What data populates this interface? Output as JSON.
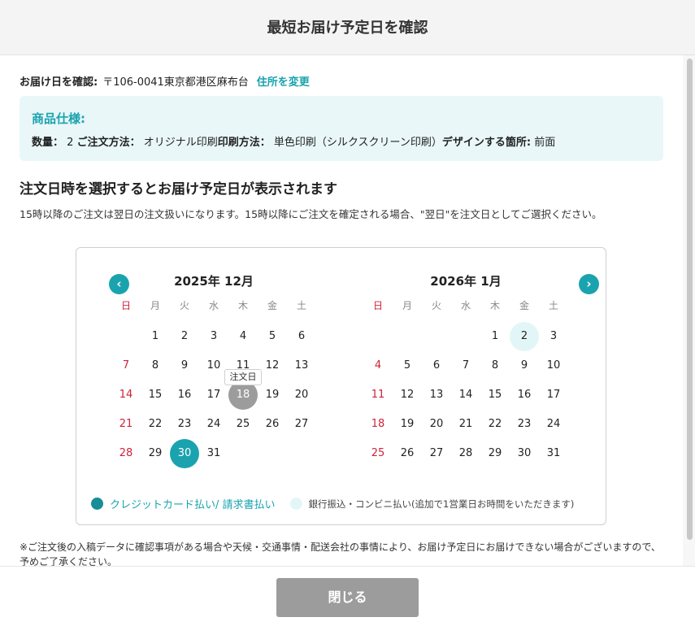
{
  "header": {
    "title": "最短お届け予定日を確認"
  },
  "address": {
    "label": "お届け日を確認:",
    "value": "〒106-0041東京都港区麻布台",
    "change_link": "住所を変更"
  },
  "spec": {
    "title": "商品仕様:",
    "quantity_label": "数量：",
    "quantity_value": "2",
    "order_method_label": "ご注文方法：",
    "order_method_value": "オリジナル印刷",
    "print_method_label": "印刷方法：",
    "print_method_value": "単色印刷（シルクスクリーン印刷）",
    "design_label": "デザインする箇所:",
    "design_value": "前面"
  },
  "section": {
    "title": "注文日時を選択するとお届け予定日が表示されます",
    "note": "15時以降のご注文は翌日の注文扱いになります。15時以降にご注文を確定される場合、\"翌日\"を注文日としてご選択ください。"
  },
  "calendar": {
    "prev_icon": "chevron-left-icon",
    "next_icon": "chevron-right-icon",
    "weekdays": [
      "日",
      "月",
      "火",
      "水",
      "木",
      "金",
      "土"
    ],
    "months": [
      {
        "title": "2025年 12月",
        "leading_blanks": 1,
        "days_in_month": 31,
        "order_day": 18,
        "order_day_label": "注文日",
        "selected_day": 30,
        "highlight_day": null
      },
      {
        "title": "2026年 1月",
        "leading_blanks": 4,
        "days_in_month": 31,
        "order_day": null,
        "order_day_label": "",
        "selected_day": null,
        "highlight_day": 2
      }
    ],
    "legend": {
      "card": "クレジットカード払い/ 請求書払い",
      "bank": "銀行振込・コンビニ払い(追加で1営業日お時間をいただきます)"
    },
    "colors": {
      "accent": "#1aa3ae",
      "order_day": "#9c9c9c",
      "sunday": "#d0213a",
      "pale": "#e3f6f7"
    }
  },
  "footnote": "※ご注文後の入稿データに確認事項がある場合や天候・交通事情・配送会社の事情により、お届け予定日にお届けできない場合がございますので、予めご了承ください。",
  "footer": {
    "close_label": "閉じる"
  }
}
